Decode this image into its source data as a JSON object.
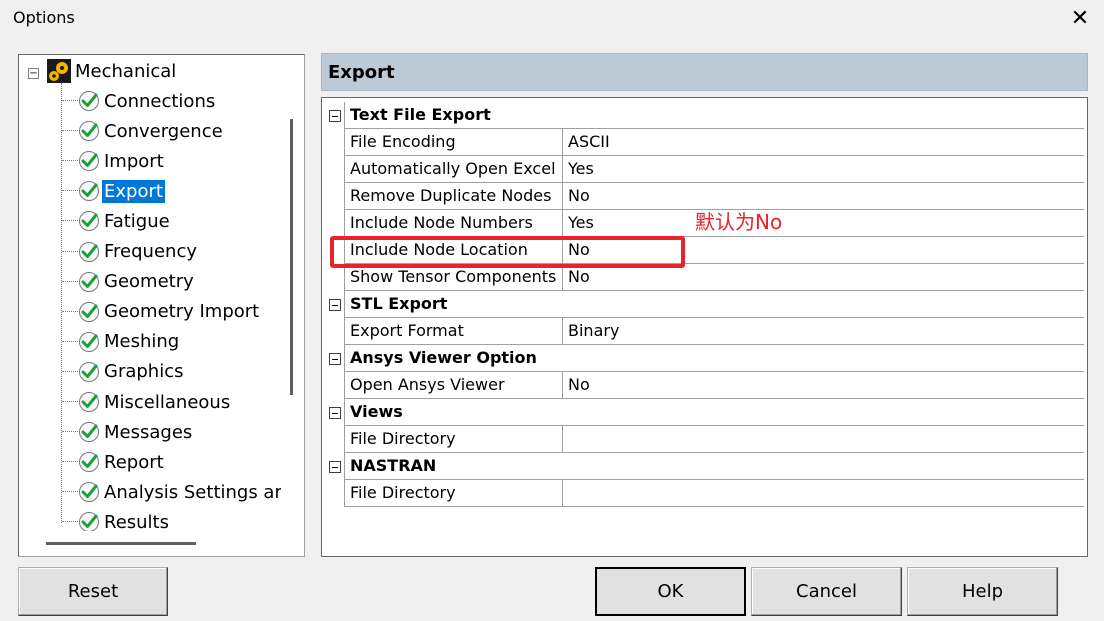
{
  "window": {
    "title": "Options",
    "close_glyph": "✕"
  },
  "tree": {
    "root": {
      "label": "Mechanical",
      "expander": "−",
      "icon": "gears-icon"
    },
    "items": [
      {
        "label": "Connections"
      },
      {
        "label": "Convergence"
      },
      {
        "label": "Import"
      },
      {
        "label": "Export",
        "selected": true
      },
      {
        "label": "Fatigue"
      },
      {
        "label": "Frequency"
      },
      {
        "label": "Geometry"
      },
      {
        "label": "Geometry Import"
      },
      {
        "label": "Meshing"
      },
      {
        "label": "Graphics"
      },
      {
        "label": "Miscellaneous"
      },
      {
        "label": "Messages"
      },
      {
        "label": "Report"
      },
      {
        "label": "Analysis Settings ar"
      },
      {
        "label": "Results"
      }
    ]
  },
  "panel": {
    "header": "Export"
  },
  "grid": {
    "categories": [
      {
        "label": "Text File Export",
        "rows": [
          {
            "name": "File Encoding",
            "value": "ASCII"
          },
          {
            "name": "Automatically Open Excel",
            "value": "Yes"
          },
          {
            "name": "Remove Duplicate Nodes",
            "value": "No"
          },
          {
            "name": "Include Node Numbers",
            "value": "Yes"
          },
          {
            "name": "Include Node Location",
            "value": "No"
          },
          {
            "name": "Show Tensor Components",
            "value": "No"
          }
        ]
      },
      {
        "label": "STL Export",
        "rows": [
          {
            "name": "Export Format",
            "value": "Binary"
          }
        ]
      },
      {
        "label": "Ansys Viewer Option",
        "rows": [
          {
            "name": "Open Ansys Viewer",
            "value": "No"
          }
        ]
      },
      {
        "label": "Views",
        "rows": [
          {
            "name": "File Directory",
            "value": ""
          }
        ]
      },
      {
        "label": "NASTRAN",
        "rows": [
          {
            "name": "File Directory",
            "value": ""
          }
        ]
      }
    ]
  },
  "annotation": {
    "text": "默认为No",
    "color": "#e8232a"
  },
  "buttons": {
    "reset": "Reset",
    "ok": "OK",
    "cancel": "Cancel",
    "help": "Help"
  },
  "colors": {
    "selection": "#0078d7",
    "header_bg": "#bccad6",
    "annotation": "#e8232a"
  }
}
